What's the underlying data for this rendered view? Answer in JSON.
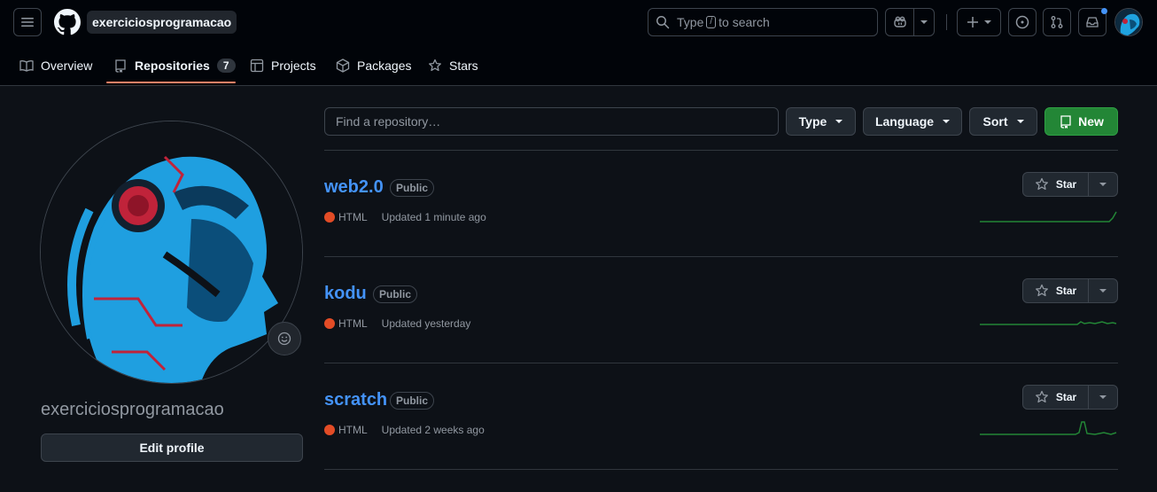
{
  "header": {
    "owner": "exerciciosprogramacao",
    "search_prefix": "Type",
    "search_key": "/",
    "search_suffix": "to search"
  },
  "tabs": [
    {
      "label": "Overview"
    },
    {
      "label": "Repositories",
      "count": "7"
    },
    {
      "label": "Projects"
    },
    {
      "label": "Packages"
    },
    {
      "label": "Stars"
    }
  ],
  "profile": {
    "username": "exerciciosprogramacao",
    "edit_label": "Edit profile"
  },
  "filters": {
    "search_placeholder": "Find a repository…",
    "type_label": "Type",
    "language_label": "Language",
    "sort_label": "Sort",
    "new_label": "New"
  },
  "repos": [
    {
      "name": "web2.0",
      "visibility": "Public",
      "language": "HTML",
      "updated": "Updated 1 minute ago",
      "star_label": "Star"
    },
    {
      "name": "kodu",
      "visibility": "Public",
      "language": "HTML",
      "updated": "Updated yesterday",
      "star_label": "Star"
    },
    {
      "name": "scratch",
      "visibility": "Public",
      "language": "HTML",
      "updated": "Updated 2 weeks ago",
      "star_label": "Star"
    }
  ],
  "colors": {
    "accent_link": "#4493f8",
    "new_button": "#238636",
    "html_language": "#e34c26",
    "tab_underline": "#f78166"
  }
}
